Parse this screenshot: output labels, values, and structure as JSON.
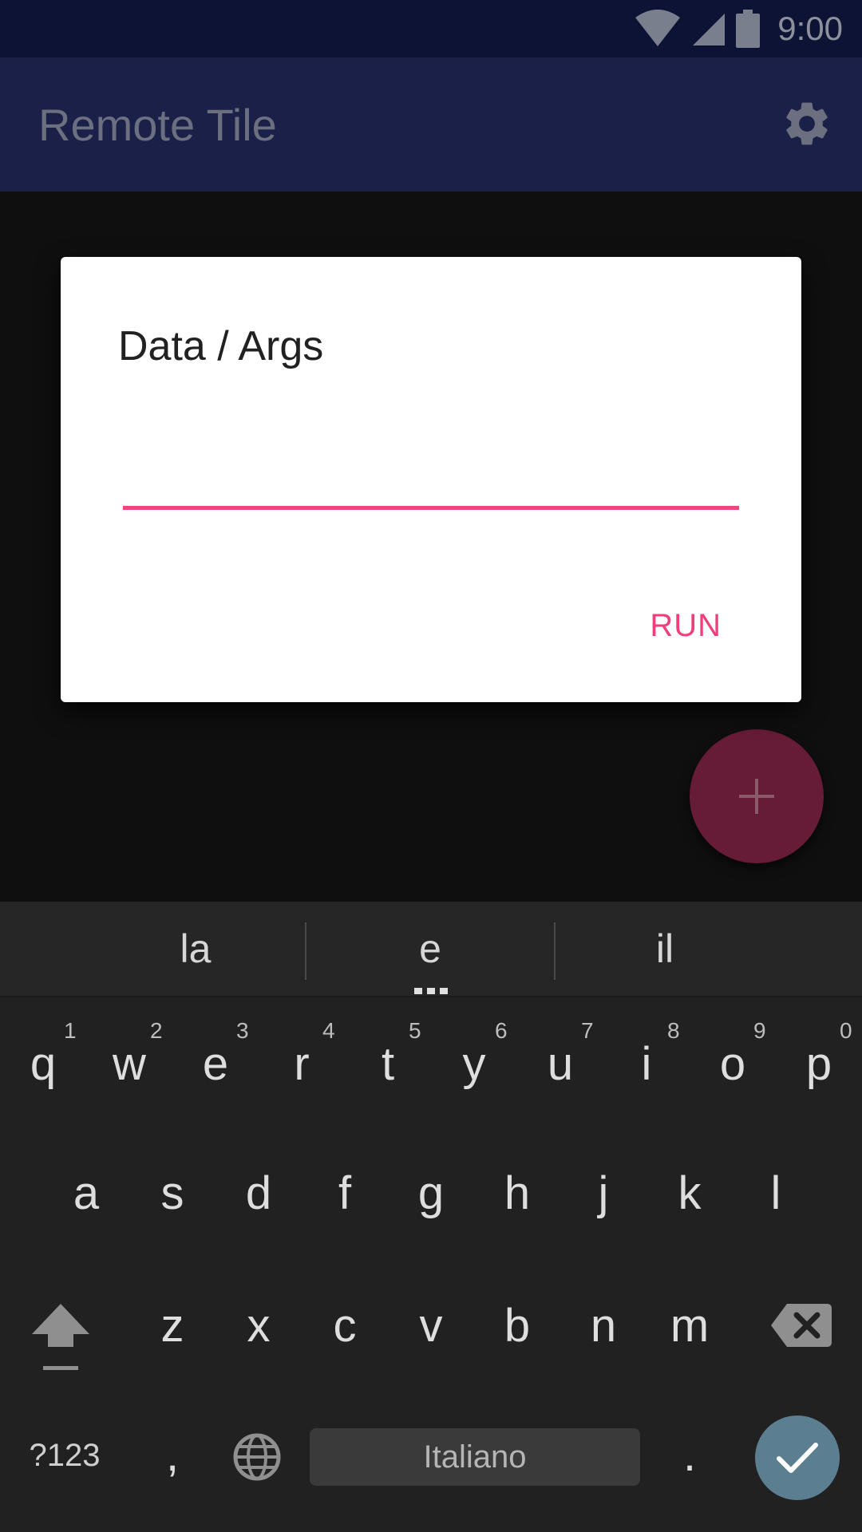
{
  "status_bar": {
    "time": "9:00",
    "icons": [
      "wifi-icon",
      "signal-icon",
      "battery-icon"
    ]
  },
  "app_bar": {
    "title": "Remote Tile",
    "settings_icon": "gear-icon"
  },
  "dialog": {
    "title": "Data / Args",
    "input_value": "",
    "run_label": "RUN",
    "accent_color": "#ee3f7c"
  },
  "fab": {
    "icon": "plus-icon",
    "color": "#661b36"
  },
  "keyboard": {
    "suggestions": [
      "la",
      "e",
      "il"
    ],
    "row1": [
      "q",
      "w",
      "e",
      "r",
      "t",
      "y",
      "u",
      "i",
      "o",
      "p"
    ],
    "row1_numbers": [
      "1",
      "2",
      "3",
      "4",
      "5",
      "6",
      "7",
      "8",
      "9",
      "0"
    ],
    "row2": [
      "a",
      "s",
      "d",
      "f",
      "g",
      "h",
      "j",
      "k",
      "l"
    ],
    "row3": [
      "z",
      "x",
      "c",
      "v",
      "b",
      "n",
      "m"
    ],
    "symbols_key": "?123",
    "comma_key": ",",
    "space_label": "Italiano",
    "period_key": ".",
    "enter_color": "#5b7f90"
  }
}
